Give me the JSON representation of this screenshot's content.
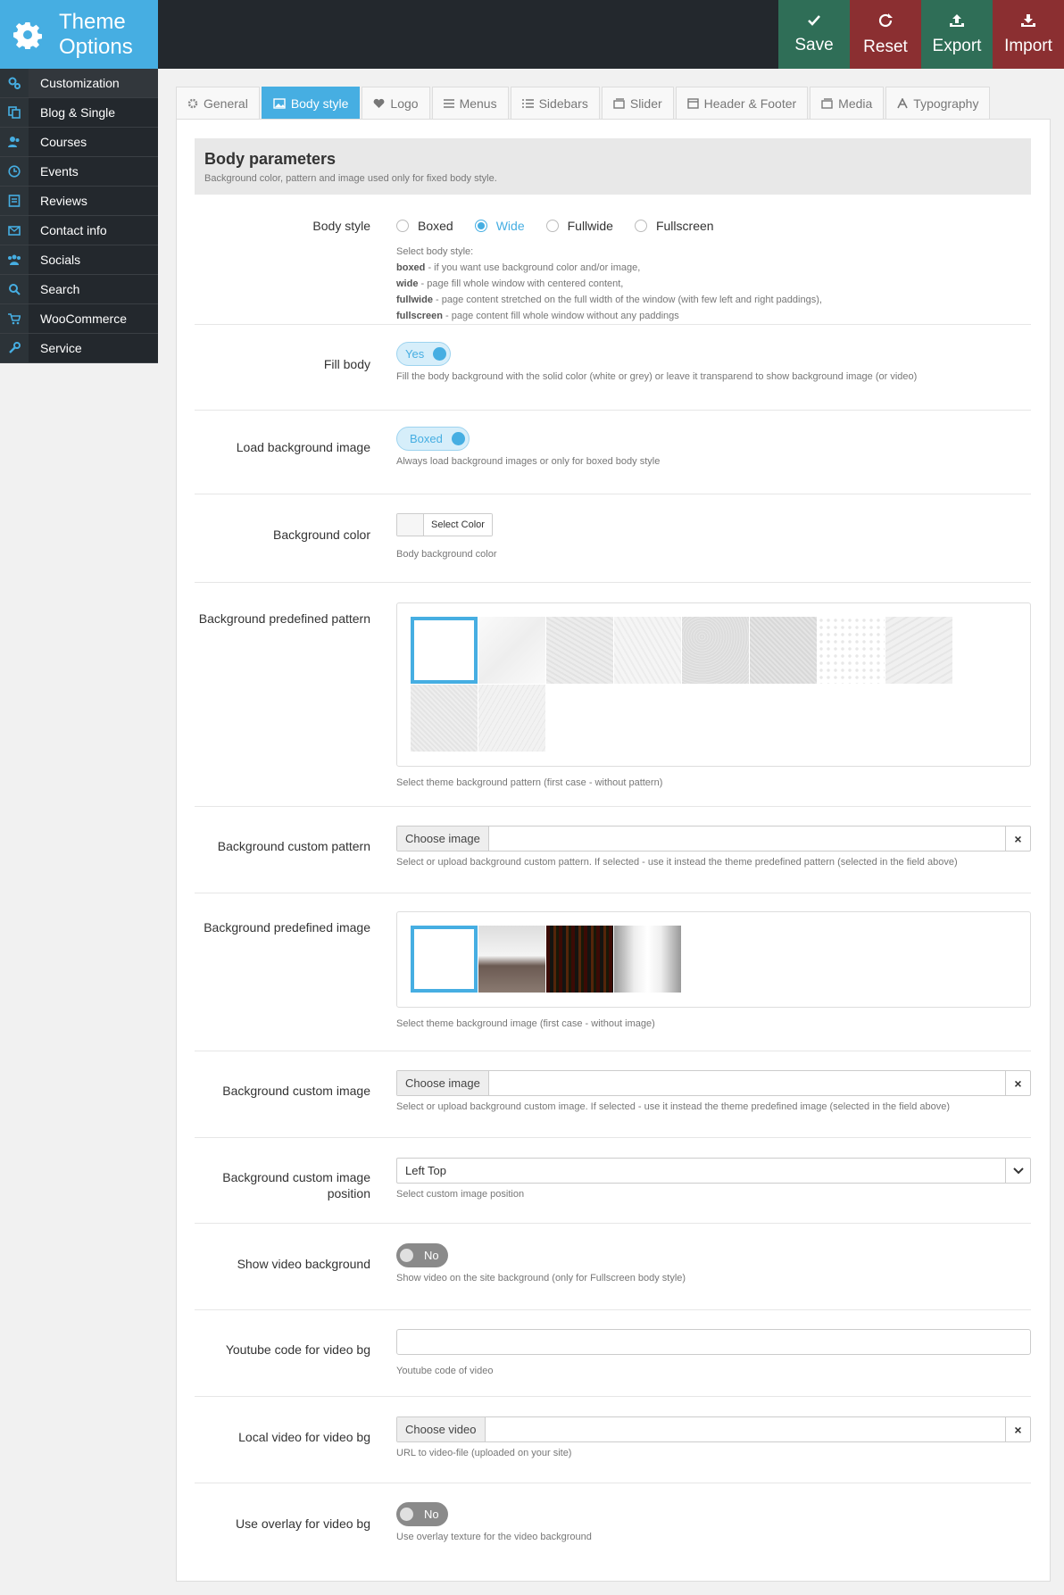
{
  "header": {
    "title_line1": "Theme",
    "title_line2": "Options",
    "actions": [
      {
        "label": "Save",
        "color": "#2f6e57"
      },
      {
        "label": "Reset",
        "color": "#8b2f31"
      },
      {
        "label": "Export",
        "color": "#2f6e57"
      },
      {
        "label": "Import",
        "color": "#8b2f31"
      }
    ]
  },
  "sidebar": {
    "items": [
      {
        "label": "Customization",
        "icon": "cogs-icon"
      },
      {
        "label": "Blog & Single",
        "icon": "copy-icon"
      },
      {
        "label": "Courses",
        "icon": "users-icon"
      },
      {
        "label": "Events",
        "icon": "clock-icon"
      },
      {
        "label": "Reviews",
        "icon": "list-icon"
      },
      {
        "label": "Contact info",
        "icon": "envelope-icon"
      },
      {
        "label": "Socials",
        "icon": "group-icon"
      },
      {
        "label": "Search",
        "icon": "search-icon"
      },
      {
        "label": "WooCommerce",
        "icon": "cart-icon"
      },
      {
        "label": "Service",
        "icon": "wrench-icon"
      }
    ]
  },
  "tabs": [
    {
      "label": "General",
      "icon": "gear-icon"
    },
    {
      "label": "Body style",
      "icon": "image-icon"
    },
    {
      "label": "Logo",
      "icon": "heart-icon"
    },
    {
      "label": "Menus",
      "icon": "menu-icon"
    },
    {
      "label": "Sidebars",
      "icon": "list-icon"
    },
    {
      "label": "Slider",
      "icon": "photo-icon"
    },
    {
      "label": "Header & Footer",
      "icon": "window-icon"
    },
    {
      "label": "Media",
      "icon": "media-icon"
    },
    {
      "label": "Typography",
      "icon": "font-icon"
    }
  ],
  "panel": {
    "title": "Body parameters",
    "subtitle": "Background color, pattern and image used only for fixed body style."
  },
  "body_style": {
    "label": "Body style",
    "options": [
      "Boxed",
      "Wide",
      "Fullwide",
      "Fullscreen"
    ],
    "selected": "Wide",
    "desc_intro": "Select body style:",
    "desc_lines": [
      {
        "k": "boxed",
        "t": " - if you want use background color and/or image,"
      },
      {
        "k": "wide",
        "t": " - page fill whole window with centered content,"
      },
      {
        "k": "fullwide",
        "t": " - page content stretched on the full width of the window (with few left and right paddings),"
      },
      {
        "k": "fullscreen",
        "t": " - page content fill whole window without any paddings"
      }
    ]
  },
  "fill_body": {
    "label": "Fill body",
    "value": "Yes",
    "desc": "Fill the body background with the solid color (white or grey) or leave it transparend to show background image (or video)"
  },
  "load_bg_image": {
    "label": "Load background image",
    "value": "Boxed",
    "desc": "Always load background images or only for boxed body style"
  },
  "bg_color": {
    "label": "Background color",
    "button": "Select Color",
    "desc": "Body background color"
  },
  "bg_pattern": {
    "label": "Background predefined pattern",
    "desc": "Select theme background pattern (first case - without pattern)"
  },
  "bg_custom_pattern": {
    "label": "Background custom pattern",
    "button": "Choose image",
    "clear": "×",
    "desc": "Select or upload background custom pattern. If selected - use it instead the theme predefined pattern (selected in the field above)"
  },
  "bg_image": {
    "label": "Background predefined image",
    "desc": "Select theme background image (first case - without image)"
  },
  "bg_custom_image": {
    "label": "Background custom image",
    "button": "Choose image",
    "clear": "×",
    "desc": "Select or upload background custom image. If selected - use it instead the theme predefined image (selected in the field above)"
  },
  "bg_image_position": {
    "label_line1": "Background custom image",
    "label_line2": "position",
    "value": "Left Top",
    "desc": "Select custom image position"
  },
  "video_bg": {
    "label": "Show video background",
    "value": "No",
    "desc": "Show video on the site background (only for Fullscreen body style)"
  },
  "youtube": {
    "label": "Youtube code for video bg",
    "desc": "Youtube code of video"
  },
  "local_video": {
    "label": "Local video for video bg",
    "button": "Choose video",
    "clear": "×",
    "desc": "URL to video-file (uploaded on your site)"
  },
  "overlay": {
    "label": "Use overlay for video bg",
    "value": "No",
    "desc": "Use overlay texture for the video background"
  }
}
